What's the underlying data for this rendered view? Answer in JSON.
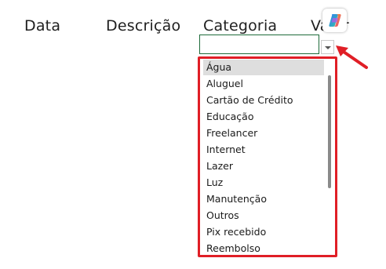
{
  "columns": {
    "data": "Data",
    "descricao": "Descrição",
    "categoria": "Categoria",
    "valor": "Valor"
  },
  "dropdown": {
    "selected_index": 0,
    "options": [
      "Água",
      "Aluguel",
      "Cartão de Crédito",
      "Educação",
      "Freelancer",
      "Internet",
      "Lazer",
      "Luz",
      "Manutenção",
      "Outros",
      "Pix recebido",
      "Reembolso"
    ]
  },
  "icons": {
    "copilot": "copilot-icon",
    "dropdown": "dropdown-arrow-icon",
    "annotation_arrow": "red-arrow-icon"
  },
  "colors": {
    "highlight_border": "#e01e26",
    "active_cell_border": "#1e6b3a",
    "selected_item_bg": "#dedede"
  }
}
